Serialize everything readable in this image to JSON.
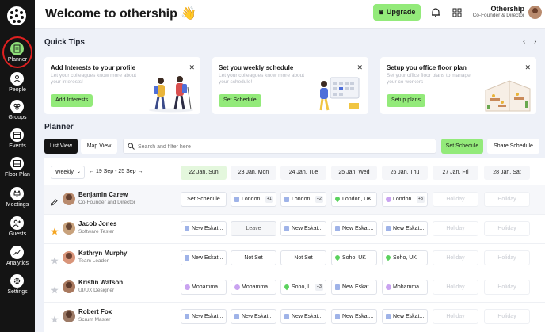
{
  "header": {
    "title": "Welcome to othership 👋",
    "upgrade_label": "Upgrade",
    "user_name": "Othership",
    "user_role": "Co-Founder & Director"
  },
  "sidebar": {
    "items": [
      {
        "label": "Planner",
        "icon": "planner-icon"
      },
      {
        "label": "People",
        "icon": "person-icon"
      },
      {
        "label": "Groups",
        "icon": "groups-icon"
      },
      {
        "label": "Events",
        "icon": "calendar-icon"
      },
      {
        "label": "Floor Plan",
        "icon": "floorplan-icon"
      },
      {
        "label": "Meetings",
        "icon": "meetings-icon"
      },
      {
        "label": "Guests",
        "icon": "guests-icon"
      },
      {
        "label": "Analytics",
        "icon": "analytics-icon"
      },
      {
        "label": "Settings",
        "icon": "gear-icon"
      }
    ]
  },
  "quick_tips": {
    "title": "Quick Tips",
    "cards": [
      {
        "title": "Add Interests to your profile",
        "desc": "Let your colleagues know more about your interests!",
        "button": "Add Interests"
      },
      {
        "title": "Set you weekly schedule",
        "desc": "Let your colleagues know more about your schedule!",
        "button": "Set Schedule"
      },
      {
        "title": "Setup you office floor plan",
        "desc": "Set your office floor plans to manage your co-workers",
        "button": "Setup plans"
      }
    ]
  },
  "planner": {
    "title": "Planner",
    "list_view": "List View",
    "map_view": "Map View",
    "search_placeholder": "Search and filter here",
    "set_schedule": "Set Schedule",
    "share_schedule": "Share Schedule",
    "range_select": "Weekly",
    "date_range": "← 19 Sep - 25 Sep →",
    "days": [
      "22 Jan, Sun",
      "23 Jan, Mon",
      "24 Jan, Tue",
      "25 Jan, Wed",
      "26 Jan, Thu",
      "27 Jan, Fri",
      "28 Jan, Sat"
    ],
    "rows": [
      {
        "name": "Benjamin Carew",
        "role": "Co-Founder and Director",
        "cells": [
          {
            "text": "Set Schedule",
            "kind": "button"
          },
          {
            "text": "London...",
            "kind": "doc",
            "plus": "+1"
          },
          {
            "text": "London...",
            "kind": "doc",
            "plus": "+2"
          },
          {
            "text": "London, UK",
            "kind": "pin"
          },
          {
            "text": "London...",
            "kind": "dot",
            "plus": "+3"
          },
          {
            "text": "Holiday",
            "kind": "holiday"
          },
          {
            "text": "Holiday",
            "kind": "holiday"
          }
        ]
      },
      {
        "name": "Jacob Jones",
        "role": "Software Tester",
        "cells": [
          {
            "text": "New Eskat...",
            "kind": "doc"
          },
          {
            "text": "Leave",
            "kind": "gray"
          },
          {
            "text": "New Eskat...",
            "kind": "doc"
          },
          {
            "text": "New Eskat...",
            "kind": "doc"
          },
          {
            "text": "New Eskat...",
            "kind": "doc"
          },
          {
            "text": "Holiday",
            "kind": "holiday"
          },
          {
            "text": "Holiday",
            "kind": "holiday"
          }
        ]
      },
      {
        "name": "Kathryn Murphy",
        "role": "Team Leader",
        "cells": [
          {
            "text": "New Eskat...",
            "kind": "doc"
          },
          {
            "text": "Not Set",
            "kind": "plain"
          },
          {
            "text": "Not Set",
            "kind": "plain"
          },
          {
            "text": "Soho, UK",
            "kind": "pin"
          },
          {
            "text": "Soho, UK",
            "kind": "pin"
          },
          {
            "text": "Holiday",
            "kind": "holiday"
          },
          {
            "text": "Holiday",
            "kind": "holiday"
          }
        ]
      },
      {
        "name": "Kristin Watson",
        "role": "UI/UX Designer",
        "cells": [
          {
            "text": "Mohamma...",
            "kind": "dot"
          },
          {
            "text": "Mohamma...",
            "kind": "dot"
          },
          {
            "text": "Soho, L...",
            "kind": "pin",
            "plus": "+3"
          },
          {
            "text": "New Eskat...",
            "kind": "doc"
          },
          {
            "text": "Mohamma...",
            "kind": "dot"
          },
          {
            "text": "Holiday",
            "kind": "holiday"
          },
          {
            "text": "Holiday",
            "kind": "holiday"
          }
        ]
      },
      {
        "name": "Robert Fox",
        "role": "Scrum Master",
        "cells": [
          {
            "text": "New Eskat...",
            "kind": "doc"
          },
          {
            "text": "New Eskat...",
            "kind": "doc"
          },
          {
            "text": "New Eskat...",
            "kind": "doc"
          },
          {
            "text": "New Eskat...",
            "kind": "doc"
          },
          {
            "text": "New Eskat...",
            "kind": "doc"
          },
          {
            "text": "Holiday",
            "kind": "holiday"
          },
          {
            "text": "Holiday",
            "kind": "holiday"
          }
        ]
      }
    ]
  },
  "colors": {
    "accent_green": "#93ea7a",
    "sidebar_bg": "#141414",
    "active_ring": "#e02020",
    "star": "#f5a623"
  }
}
